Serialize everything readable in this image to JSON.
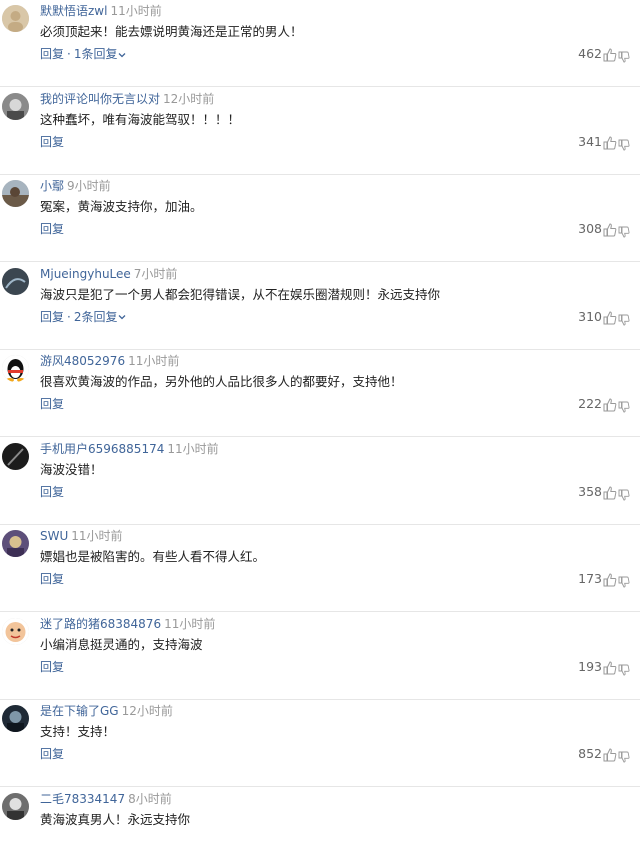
{
  "comments": [
    {
      "user": "默默悟语zwl",
      "time": "11小时前",
      "text": "必须顶起来！能去嫖说明黄海还是正常的男人！",
      "reply": "回复",
      "more": "1条回复",
      "likes": "462",
      "avatar": "avatar-beige"
    },
    {
      "user": "我的评论叫你无言以对",
      "time": "12小时前",
      "text": "这种蠢坏，唯有海波能驾驭！！！！",
      "reply": "回复",
      "more": "",
      "likes": "341",
      "avatar": "avatar-man"
    },
    {
      "user": "小鄢",
      "time": "9小时前",
      "text": "冤案，黄海波支持你，加油。",
      "reply": "回复",
      "more": "",
      "likes": "308",
      "avatar": "avatar-photo"
    },
    {
      "user": "MjueingyhuLee",
      "time": "7小时前",
      "text": "海波只是犯了一个男人都会犯得错误，从不在娱乐圈潜规则！永远支持你",
      "reply": "回复",
      "more": "2条回复",
      "likes": "310",
      "avatar": "avatar-dark"
    },
    {
      "user": "游风48052976",
      "time": "11小时前",
      "text": "很喜欢黄海波的作品，另外他的人品比很多人的都要好，支持他！",
      "reply": "回复",
      "more": "",
      "likes": "222",
      "avatar": "avatar-qq"
    },
    {
      "user": "手机用户6596885174",
      "time": "11小时前",
      "text": "海波没错！",
      "reply": "回复",
      "more": "",
      "likes": "358",
      "avatar": "avatar-black"
    },
    {
      "user": "SWU",
      "time": "11小时前",
      "text": "嫖娼也是被陷害的。有些人看不得人红。",
      "reply": "回复",
      "more": "",
      "likes": "173",
      "avatar": "avatar-purple"
    },
    {
      "user": "迷了路的猪68384876",
      "time": "11小时前",
      "text": "小编消息挺灵通的，支持海波",
      "reply": "回复",
      "more": "",
      "likes": "193",
      "avatar": "avatar-cartoon"
    },
    {
      "user": "是在下输了GG",
      "time": "12小时前",
      "text": "支持！支持！",
      "reply": "回复",
      "more": "",
      "likes": "852",
      "avatar": "avatar-night"
    },
    {
      "user": "二毛78334147",
      "time": "8小时前",
      "text": "黄海波真男人！永远支持你",
      "reply": "",
      "more": "",
      "likes": "",
      "avatar": "avatar-gray"
    }
  ],
  "separator": "·",
  "icons": {
    "like": "thumbs-up-icon",
    "dislike": "thumbs-down-icon",
    "expand": "chevron-down-icon"
  },
  "colors": {
    "username": "#406599",
    "time": "#999999",
    "text": "#222222",
    "divider": "#e6e6e6"
  }
}
